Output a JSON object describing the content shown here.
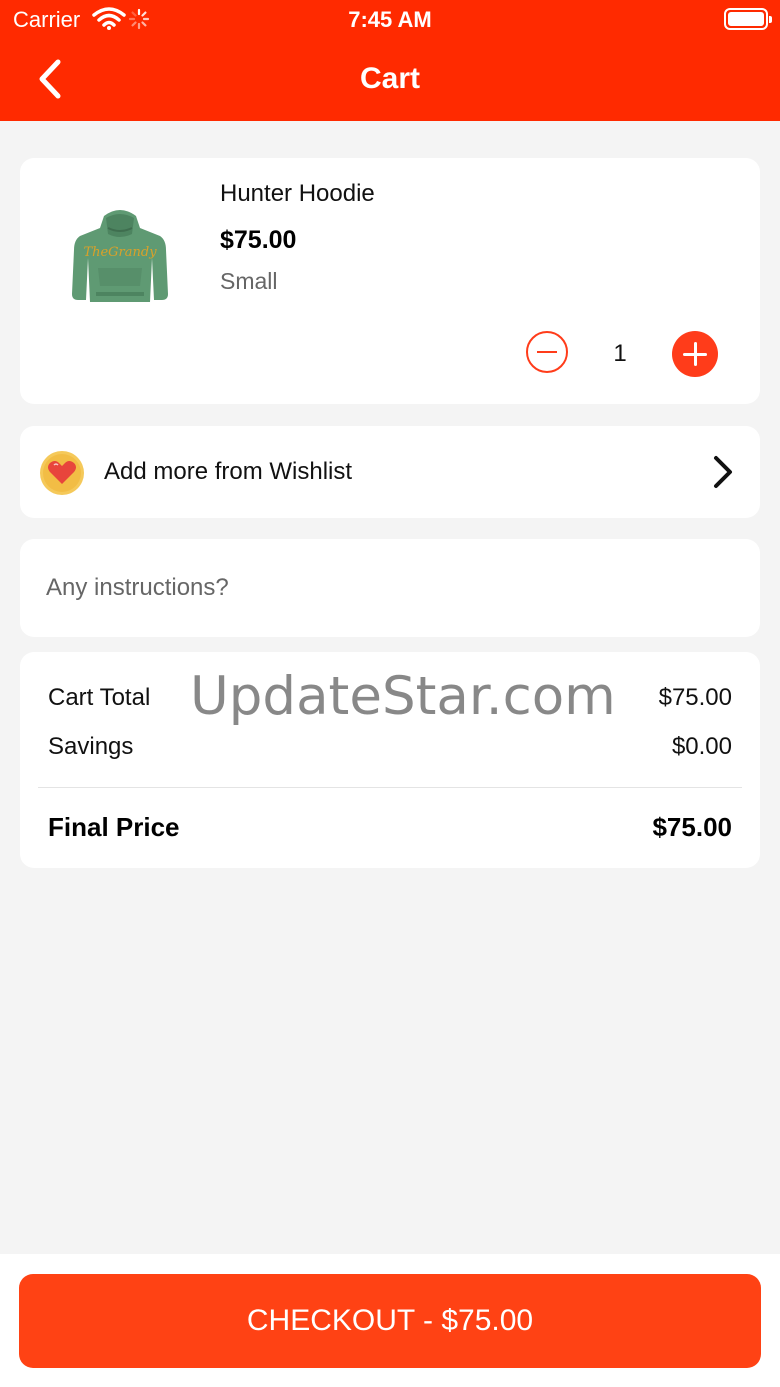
{
  "status_bar": {
    "carrier": "Carrier",
    "time": "7:45 AM"
  },
  "header": {
    "title": "Cart",
    "back_icon": "chevron-left-icon"
  },
  "cart_item": {
    "name": "Hunter Hoodie",
    "price": "$75.00",
    "size": "Small",
    "quantity": "1",
    "image_icon": "green-hoodie-image"
  },
  "wishlist": {
    "label": "Add more from Wishlist",
    "icon": "heart-icon"
  },
  "instructions": {
    "placeholder": "Any instructions?"
  },
  "summary": {
    "cart_total_label": "Cart Total",
    "cart_total_value": "$75.00",
    "savings_label": "Savings",
    "savings_value": "$0.00",
    "final_label": "Final Price",
    "final_value": "$75.00"
  },
  "watermark": "UpdateStar.com",
  "checkout": {
    "label": "CHECKOUT - $75.00"
  },
  "colors": {
    "header": "#ff2a00",
    "accent": "#ff3c1a",
    "checkout": "#ff4214",
    "background": "#f4f4f4"
  }
}
